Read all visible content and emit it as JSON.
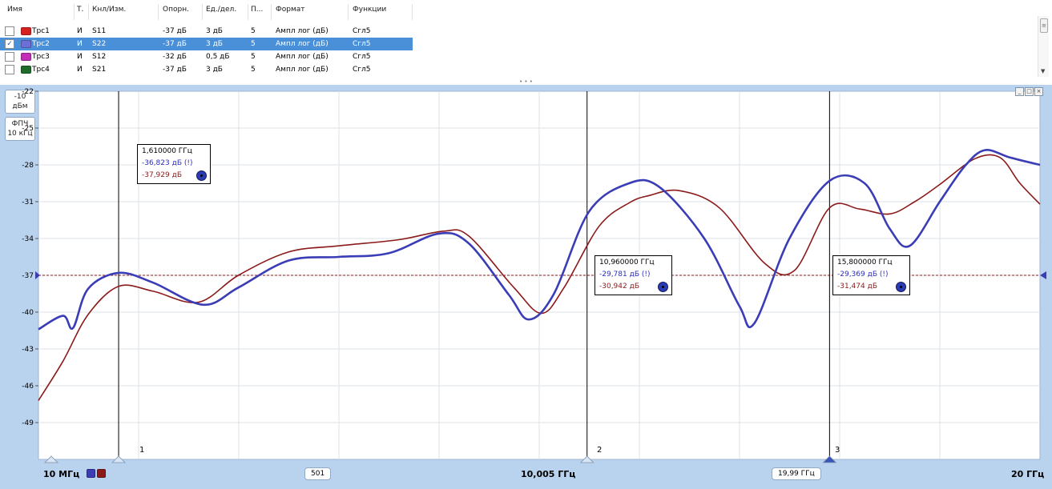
{
  "table": {
    "headers": [
      "Имя",
      "Т.",
      "Кнл/Изм.",
      "Опорн.",
      "Ед./дел.",
      "П...",
      "Формат",
      "Функции"
    ],
    "rows": [
      {
        "checked": "",
        "color": "#d61f1f",
        "name": "Трс1",
        "type": "И",
        "meas": "S11",
        "ref": "-37 дБ",
        "scale": "3 дБ",
        "p": "5",
        "format": "Ампл лог (дБ)",
        "func": "Сгл5"
      },
      {
        "checked": "✓",
        "color": "#6b6fd6",
        "name": "Трс2",
        "type": "И",
        "meas": "S22",
        "ref": "-37 дБ",
        "scale": "3 дБ",
        "p": "5",
        "format": "Ампл лог (дБ)",
        "func": "Сгл5"
      },
      {
        "checked": "",
        "color": "#c02fb5",
        "name": "Трс3",
        "type": "И",
        "meas": "S12",
        "ref": "-32 дБ",
        "scale": "0,5 дБ",
        "p": "5",
        "format": "Ампл лог (дБ)",
        "func": "Сгл5"
      },
      {
        "checked": "",
        "color": "#1f6b2a",
        "name": "Трс4",
        "type": "И",
        "meas": "S21",
        "ref": "-37 дБ",
        "scale": "3 дБ",
        "p": "5",
        "format": "Ампл лог (дБ)",
        "func": "Сгл5"
      }
    ],
    "scroll_thumb_icon": "≡",
    "scroll_down_icon": "▼"
  },
  "splitter_icon": "• • •",
  "side": {
    "ref_level_value": "-10",
    "ref_level_unit": "дБм",
    "filter_label": "ФПЧ",
    "filter_value": "10 кГц"
  },
  "window_buttons": [
    "_",
    "□",
    "×"
  ],
  "chart_data": {
    "type": "line",
    "title": "",
    "xlabel": "",
    "ylabel": "",
    "xlim_ghz": [
      0.01,
      20
    ],
    "ylim_db": [
      -52,
      -22
    ],
    "yticks": [
      "-22",
      "-25",
      "-28",
      "-31",
      "-34",
      "-37",
      "-40",
      "-43",
      "-46",
      "-49"
    ],
    "ref_line_db": -37,
    "grid": true,
    "series": [
      {
        "name": "Трс1",
        "color": "#8b1a1a",
        "points": [
          [
            0.01,
            -47.2
          ],
          [
            0.5,
            -44
          ],
          [
            1,
            -40.2
          ],
          [
            1.61,
            -37.9
          ],
          [
            2.3,
            -38.3
          ],
          [
            3.2,
            -39.2
          ],
          [
            4,
            -37
          ],
          [
            5,
            -35.1
          ],
          [
            6,
            -34.6
          ],
          [
            7.2,
            -34.1
          ],
          [
            8.1,
            -33.4
          ],
          [
            8.6,
            -33.8
          ],
          [
            9.5,
            -38
          ],
          [
            10.05,
            -40.1
          ],
          [
            10.5,
            -38
          ],
          [
            11.2,
            -33
          ],
          [
            11.8,
            -31.1
          ],
          [
            12.2,
            -30.5
          ],
          [
            12.8,
            -30.1
          ],
          [
            13.6,
            -31.5
          ],
          [
            14.5,
            -36
          ],
          [
            15.1,
            -36.6
          ],
          [
            15.8,
            -31.5
          ],
          [
            16.4,
            -31.6
          ],
          [
            17,
            -32
          ],
          [
            17.5,
            -31
          ],
          [
            18,
            -29.6
          ],
          [
            18.7,
            -27.5
          ],
          [
            19.2,
            -27.4
          ],
          [
            19.6,
            -29.5
          ],
          [
            20,
            -31.2
          ]
        ]
      },
      {
        "name": "Трс2",
        "color": "#3a3db5",
        "points": [
          [
            0.01,
            -41.4
          ],
          [
            0.5,
            -40.3
          ],
          [
            0.7,
            -41.3
          ],
          [
            1,
            -38.1
          ],
          [
            1.61,
            -36.8
          ],
          [
            2.3,
            -37.6
          ],
          [
            3.3,
            -39.4
          ],
          [
            4,
            -38
          ],
          [
            5,
            -35.8
          ],
          [
            6,
            -35.5
          ],
          [
            7,
            -35.2
          ],
          [
            8,
            -33.6
          ],
          [
            8.6,
            -34.4
          ],
          [
            9.4,
            -38.6
          ],
          [
            9.8,
            -40.6
          ],
          [
            10.3,
            -38.5
          ],
          [
            11,
            -31.8
          ],
          [
            11.8,
            -29.5
          ],
          [
            12.4,
            -29.8
          ],
          [
            13.3,
            -34
          ],
          [
            14,
            -39.5
          ],
          [
            14.3,
            -40.9
          ],
          [
            15,
            -34
          ],
          [
            15.8,
            -29.3
          ],
          [
            16.5,
            -29.5
          ],
          [
            17,
            -33.2
          ],
          [
            17.4,
            -34.6
          ],
          [
            18,
            -31
          ],
          [
            18.5,
            -28.1
          ],
          [
            18.9,
            -26.8
          ],
          [
            19.4,
            -27.4
          ],
          [
            20,
            -28
          ]
        ]
      }
    ],
    "markers": [
      {
        "num": "1",
        "freq": "1,610000 ГГц",
        "val_trace2": "-36,823 дБ (!)",
        "val_trace1": "-37,929 дБ",
        "x_ghz": 1.61
      },
      {
        "num": "2",
        "freq": "10,960000 ГГц",
        "val_trace2": "-29,781 дБ (!)",
        "val_trace1": "-30,942 дБ",
        "x_ghz": 10.96
      },
      {
        "num": "3",
        "freq": "15,800000 ГГц",
        "val_trace2": "-29,369 дБ (!)",
        "val_trace1": "-31,474 дБ",
        "x_ghz": 15.8
      }
    ]
  },
  "bottom": {
    "start_freq": "10 МГц",
    "points": "501",
    "center_freq": "10,005 ГГц",
    "span": "19,99 ГГц",
    "stop_freq": "20 ГГц",
    "trace_colors": [
      "#3a3db5",
      "#8b1a1a"
    ]
  }
}
